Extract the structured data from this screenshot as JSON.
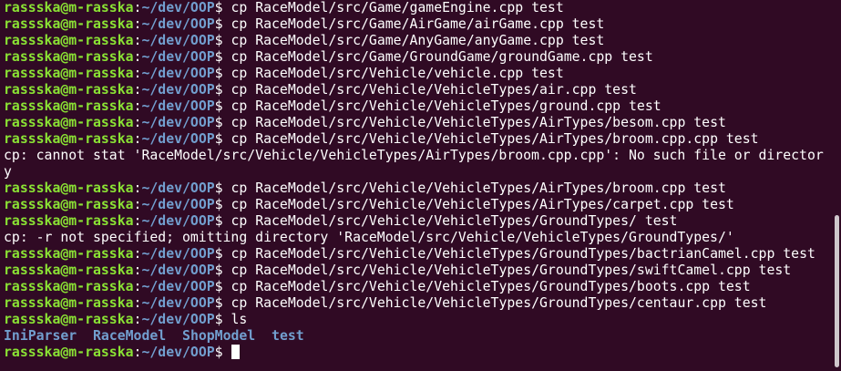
{
  "prompt": {
    "user": "rassska@m-rasska",
    "sep": ":",
    "path": "~/dev/OOP",
    "symbol": "$ "
  },
  "lines": [
    {
      "type": "cmd",
      "text": "cp RaceModel/src/Game/gameEngine.cpp test"
    },
    {
      "type": "cmd",
      "text": "cp RaceModel/src/Game/AirGame/airGame.cpp test"
    },
    {
      "type": "cmd",
      "text": "cp RaceModel/src/Game/AnyGame/anyGame.cpp test"
    },
    {
      "type": "cmd",
      "text": "cp RaceModel/src/Game/GroundGame/groundGame.cpp test"
    },
    {
      "type": "cmd",
      "text": "cp RaceModel/src/Vehicle/vehicle.cpp test"
    },
    {
      "type": "cmd",
      "text": "cp RaceModel/src/Vehicle/VehicleTypes/air.cpp test"
    },
    {
      "type": "cmd",
      "text": "cp RaceModel/src/Vehicle/VehicleTypes/ground.cpp test"
    },
    {
      "type": "cmd",
      "text": "cp RaceModel/src/Vehicle/VehicleTypes/AirTypes/besom.cpp test"
    },
    {
      "type": "cmd",
      "text": "cp RaceModel/src/Vehicle/VehicleTypes/AirTypes/broom.cpp.cpp test"
    },
    {
      "type": "out",
      "text": "cp: cannot stat 'RaceModel/src/Vehicle/VehicleTypes/AirTypes/broom.cpp.cpp': No such file or director"
    },
    {
      "type": "out",
      "text": "y"
    },
    {
      "type": "cmd",
      "text": "cp RaceModel/src/Vehicle/VehicleTypes/AirTypes/broom.cpp test"
    },
    {
      "type": "cmd",
      "text": "cp RaceModel/src/Vehicle/VehicleTypes/AirTypes/carpet.cpp test"
    },
    {
      "type": "cmd",
      "text": "cp RaceModel/src/Vehicle/VehicleTypes/GroundTypes/ test"
    },
    {
      "type": "out",
      "text": "cp: -r not specified; omitting directory 'RaceModel/src/Vehicle/VehicleTypes/GroundTypes/'"
    },
    {
      "type": "cmd",
      "text": "cp RaceModel/src/Vehicle/VehicleTypes/GroundTypes/bactrianCamel.cpp test"
    },
    {
      "type": "cmd",
      "text": "cp RaceModel/src/Vehicle/VehicleTypes/GroundTypes/swiftCamel.cpp test"
    },
    {
      "type": "cmd",
      "text": "cp RaceModel/src/Vehicle/VehicleTypes/GroundTypes/boots.cpp test"
    },
    {
      "type": "cmd",
      "text": "cp RaceModel/src/Vehicle/VehicleTypes/GroundTypes/centaur.cpp test"
    },
    {
      "type": "cmd",
      "text": "ls"
    },
    {
      "type": "ls",
      "items": [
        "IniParser",
        "RaceModel",
        "ShopModel",
        "test"
      ]
    },
    {
      "type": "cmd",
      "text": ""
    }
  ],
  "colors": {
    "background": "#300a24",
    "user": "#8ae234",
    "path": "#729fcf",
    "text": "#ffffff"
  }
}
